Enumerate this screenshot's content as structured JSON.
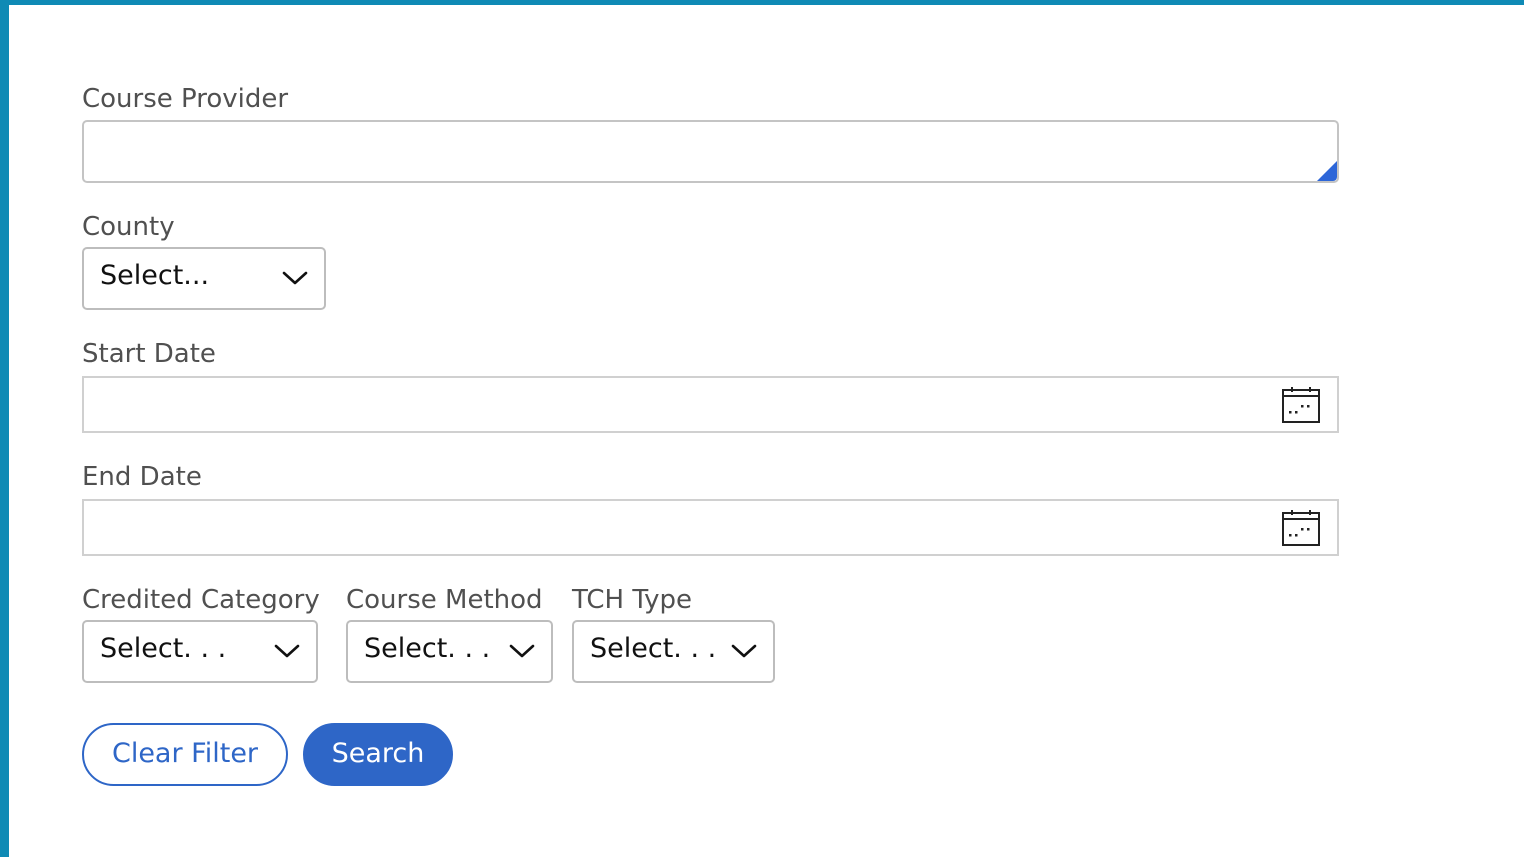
{
  "form": {
    "course_provider": {
      "label": "Course Provider",
      "value": ""
    },
    "county": {
      "label": "County",
      "value": "Select..."
    },
    "start_date": {
      "label": "Start Date",
      "value": "",
      "icon": "calendar-icon"
    },
    "end_date": {
      "label": "End Date",
      "value": "",
      "icon": "calendar-icon"
    },
    "credited_category": {
      "label": "Credited Category",
      "value": "Select. . ."
    },
    "course_method": {
      "label": "Course Method",
      "value": "Select. . ."
    },
    "tch_type": {
      "label": "TCH Type",
      "value": "Select. . ."
    }
  },
  "buttons": {
    "clear_filter": "Clear Filter",
    "search": "Search"
  },
  "colors": {
    "frame": "#0f8ab5",
    "accent": "#2e66c7",
    "label": "#505050"
  }
}
